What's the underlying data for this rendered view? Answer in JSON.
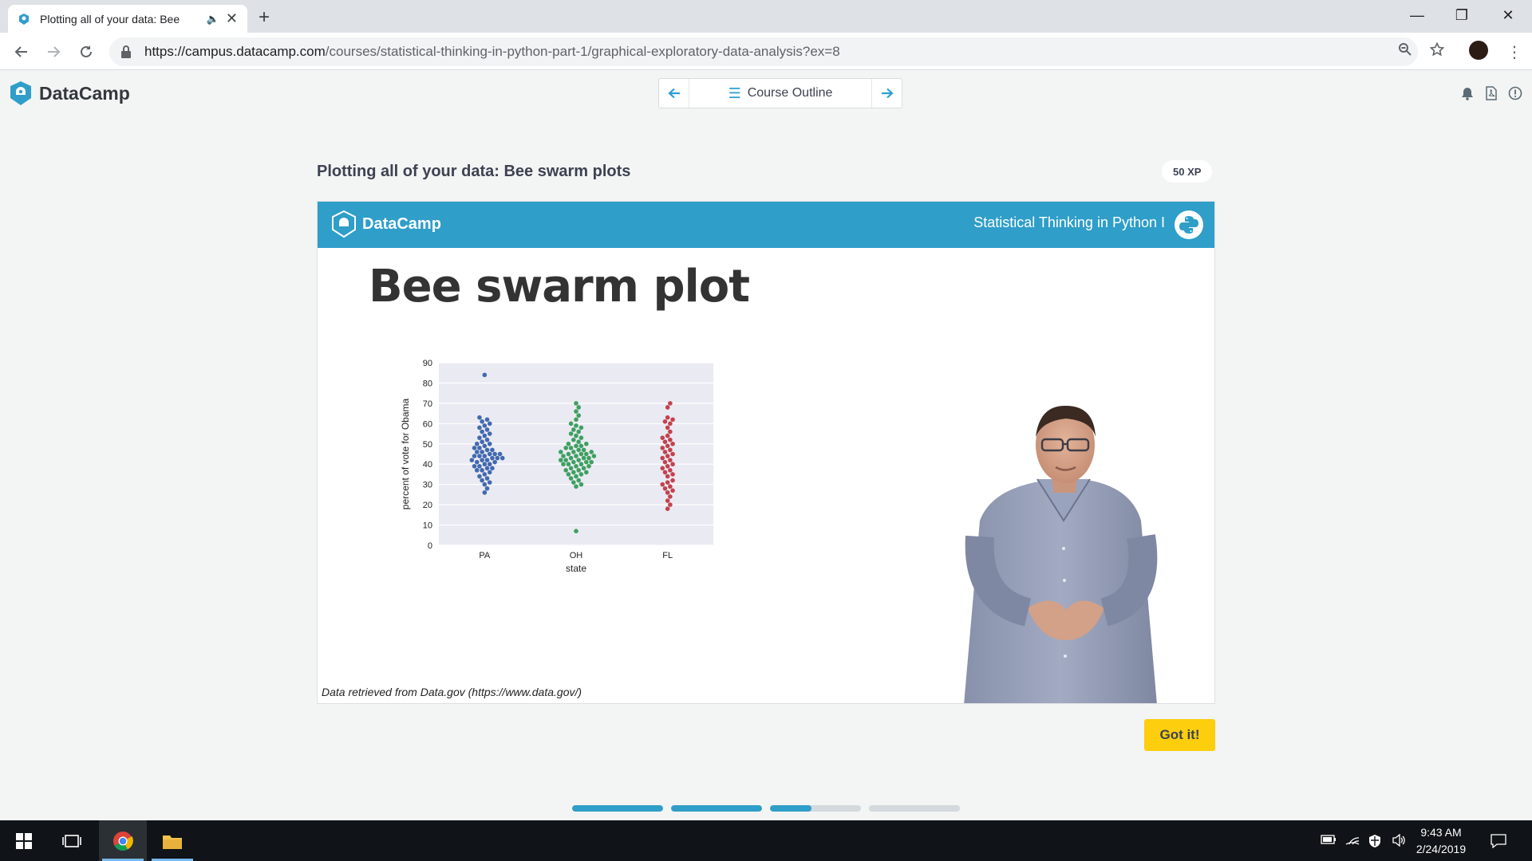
{
  "browser": {
    "tab_title": "Plotting all of your data: Bee",
    "url_host": "https://campus.datacamp.com",
    "url_path": "/courses/statistical-thinking-in-python-part-1/graphical-exploratory-data-analysis?ex=8",
    "icons": [
      "back-icon",
      "forward-icon",
      "reload-icon",
      "lock-icon",
      "zoom-icon",
      "star-icon",
      "menu-icon"
    ]
  },
  "header": {
    "brand": "DataCamp",
    "course_outline_label": "Course Outline",
    "icons": [
      "bell-icon",
      "pdf-icon",
      "alert-icon"
    ]
  },
  "exercise": {
    "title": "Plotting all of your data: Bee swarm plots",
    "xp": "50 XP",
    "got_it": "Got it!",
    "progress": [
      1.0,
      1.0,
      0.46,
      0.0
    ]
  },
  "slide": {
    "brand": "DataCamp",
    "course": "Statistical Thinking in Python I",
    "heading": "Bee swarm plot",
    "credit": "Data retrieved from Data.gov (https://www.data.gov/)"
  },
  "chart_data": {
    "type": "scatter",
    "subtype": "beeswarm",
    "xlabel": "state",
    "ylabel": "percent of vote for Obama",
    "categories": [
      "PA",
      "OH",
      "FL"
    ],
    "ylim": [
      0,
      90
    ],
    "yticks": [
      0,
      10,
      20,
      30,
      40,
      50,
      60,
      70,
      80,
      90
    ],
    "grid": true,
    "series": [
      {
        "color": "#4169b0",
        "values": [
          84,
          63,
          62,
          61,
          60,
          59,
          58,
          57,
          56,
          55,
          54,
          53,
          52,
          51,
          50,
          50,
          49,
          48,
          48,
          47,
          47,
          46,
          46,
          45,
          45,
          45,
          44,
          44,
          44,
          43,
          43,
          43,
          42,
          42,
          42,
          41,
          41,
          40,
          40,
          39,
          39,
          38,
          38,
          37,
          37,
          36,
          35,
          34,
          33,
          32,
          31,
          30,
          28,
          26
        ]
      },
      {
        "color": "#3ea060",
        "values": [
          70,
          68,
          66,
          64,
          62,
          60,
          59,
          58,
          57,
          56,
          55,
          54,
          53,
          52,
          51,
          50,
          50,
          49,
          49,
          48,
          48,
          47,
          47,
          46,
          46,
          46,
          45,
          45,
          45,
          44,
          44,
          44,
          43,
          43,
          43,
          42,
          42,
          42,
          41,
          41,
          41,
          40,
          40,
          40,
          39,
          39,
          38,
          38,
          37,
          37,
          36,
          36,
          35,
          35,
          34,
          33,
          32,
          31,
          30,
          29,
          7
        ]
      },
      {
        "color": "#c2424d",
        "values": [
          70,
          68,
          63,
          62,
          61,
          60,
          58,
          56,
          54,
          53,
          52,
          51,
          50,
          49,
          48,
          47,
          46,
          45,
          44,
          43,
          42,
          41,
          40,
          39,
          38,
          37,
          36,
          35,
          34,
          32,
          31,
          30,
          29,
          28,
          27,
          26,
          24,
          22,
          20,
          18
        ]
      }
    ]
  },
  "taskbar": {
    "time": "9:43 AM",
    "date": "2/24/2019"
  }
}
